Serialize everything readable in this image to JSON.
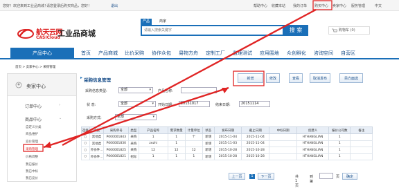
{
  "topbar": {
    "welcome": "您好！欢迎来到工业品商城！",
    "login_hint": "请您登录后购买商品，您好！",
    "logout": "退出",
    "links": [
      "帮助中心",
      "收藏本站",
      "我的订单",
      "购买中心",
      "卖家中心",
      "服务管理",
      "中文"
    ]
  },
  "logo": {
    "cn": "航天云网",
    "en": "CASICloud",
    "title": "工业品商城"
  },
  "search": {
    "tabs": [
      "产品",
      "商家"
    ],
    "placeholder": "请输入搜索关键字",
    "button": "搜 索"
  },
  "cart": {
    "label": "购物车 (0)"
  },
  "nav": {
    "current": "产品中心",
    "items": [
      "首页",
      "产品商城",
      "比价采购",
      "协作众包",
      "易物方舟",
      "定制工厂",
      "监理测试",
      "应用围地",
      "众创孵化",
      "咨询空间",
      "自营区"
    ]
  },
  "breadcrumb": "首页 > 卖家中心 > 采购管理",
  "sidebar": {
    "title": "卖家中心",
    "groups": [
      "订单中心",
      "商品中心"
    ],
    "items": [
      "自定义分类",
      "商品维护",
      "竞价管理",
      "采购管理",
      "价格调整",
      "我已报价",
      "我已中标",
      "我已竞价"
    ]
  },
  "panel": {
    "title": "采购信息管理",
    "buttons": [
      "新增",
      "修改",
      "查看",
      "取消发布",
      "另方面选"
    ]
  },
  "filters": {
    "type_label": "采购信息类型:",
    "type_value": "全部",
    "name_label": "产品名称:",
    "status_label": "状    态:",
    "status_value": "全部",
    "date_label": "开始日期:",
    "date_value": "20151017",
    "end_label": "结束日期:",
    "end_value": "20151114",
    "method_label": "采购方式:",
    "method_value": "全部"
  },
  "table": {
    "headers": [
      "选择",
      "大类",
      "采购单号",
      "类型",
      "产品名称",
      "需求数量",
      "计量单位",
      "状态",
      "发布日期",
      "截止日期",
      "中标日期",
      "创建人",
      "报价公司数",
      "备注"
    ],
    "rows": [
      [
        "○",
        "其他类",
        "P000001843",
        "采购",
        "1",
        "1",
        "个",
        "新增",
        "2015-11-04",
        "2015-11-04",
        "",
        "HTHANGLIAN",
        "1",
        ""
      ],
      [
        "○",
        "其他类",
        "P000001830",
        "采购",
        "zezhi",
        "1",
        "",
        "新增",
        "2015-11-03",
        "2015-11-04",
        "",
        "HTHANGLIAN",
        "1",
        ""
      ],
      [
        "○",
        "外协件...",
        "P000001825",
        "采购",
        "12",
        "12",
        "12",
        "新增",
        "2015-10-28",
        "2015-10-28",
        "",
        "HTHANGLIAN",
        "1",
        ""
      ],
      [
        "○",
        "外协件...",
        "P000001821",
        "招标",
        "1",
        "1",
        "1",
        "新增",
        "2015-10-28",
        "2015-10-28",
        "",
        "HTHANGLIAN",
        "1",
        ""
      ]
    ]
  },
  "pager": {
    "prev": "上一页",
    "page": "1",
    "next": "下一页",
    "total": "共1页",
    "goto": "到第",
    "unit": "页",
    "confirm": "确定"
  },
  "colors": {
    "accent": "#1a6fb8",
    "annotation": "#e02424",
    "brand": "#d22222"
  }
}
